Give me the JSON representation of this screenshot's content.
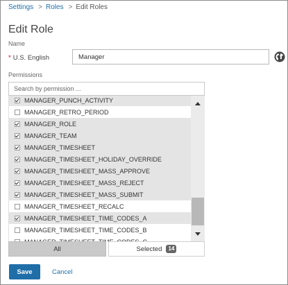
{
  "breadcrumb": {
    "items": [
      "Settings",
      "Roles"
    ],
    "separator": ">",
    "current": "Edit Roles"
  },
  "page": {
    "title": "Edit Role",
    "name_section_label": "Name"
  },
  "name_field": {
    "required_marker": "*",
    "language_label": "U.S. English",
    "value": "Manager",
    "language_icon": "globe-icon"
  },
  "permissions": {
    "section_label": "Permissions",
    "search_placeholder": "Search by permission ...",
    "items": [
      {
        "label": "MANAGER_PUNCH_ACTIVITY",
        "checked": true
      },
      {
        "label": "MANAGER_RETRO_PERIOD",
        "checked": false
      },
      {
        "label": "MANAGER_ROLE",
        "checked": true
      },
      {
        "label": "MANAGER_TEAM",
        "checked": true
      },
      {
        "label": "MANAGER_TIMESHEET",
        "checked": true
      },
      {
        "label": "MANAGER_TIMESHEET_HOLIDAY_OVERRIDE",
        "checked": true
      },
      {
        "label": "MANAGER_TIMESHEET_MASS_APPROVE",
        "checked": true
      },
      {
        "label": "MANAGER_TIMESHEET_MASS_REJECT",
        "checked": true
      },
      {
        "label": "MANAGER_TIMESHEET_MASS_SUBMIT",
        "checked": true
      },
      {
        "label": "MANAGER_TIMESHEET_RECALC",
        "checked": false
      },
      {
        "label": "MANAGER_TIMESHEET_TIME_CODES_A",
        "checked": true
      },
      {
        "label": "MANAGER_TIMESHEET_TIME_CODES_B",
        "checked": false
      },
      {
        "label": "MANAGER_TIMESHEET_TIME_CODES_C",
        "checked": false
      }
    ],
    "tabs": {
      "all_label": "All",
      "selected_label": "Selected",
      "selected_count": "14"
    }
  },
  "actions": {
    "save_label": "Save",
    "cancel_label": "Cancel"
  },
  "colors": {
    "accent": "#1f6ea8",
    "required": "#d0021b",
    "checked_row": "#e4e4e4"
  }
}
